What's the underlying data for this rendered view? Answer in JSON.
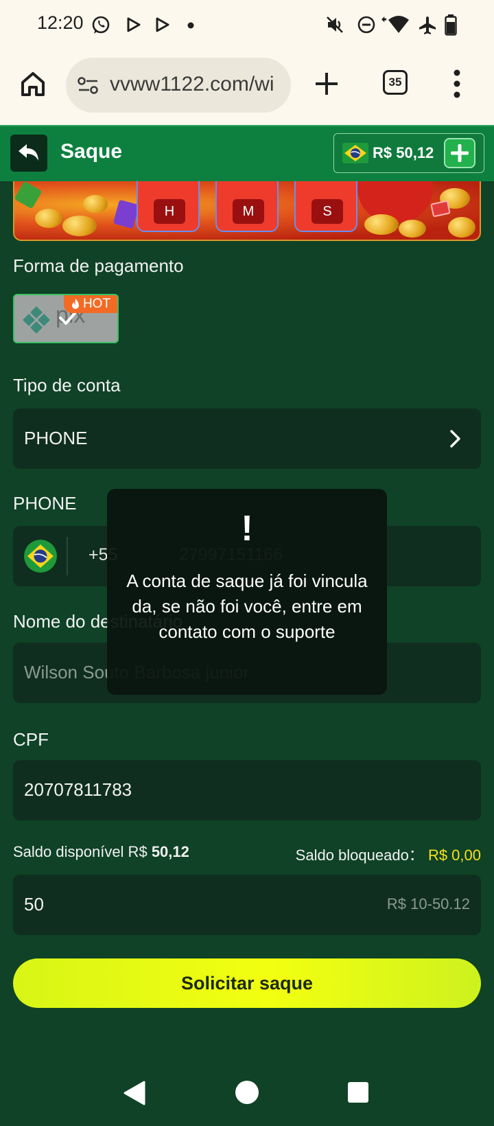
{
  "status_bar": {
    "time": "12:20",
    "left_icons": [
      "whatsapp-icon",
      "play-store-icon",
      "play-store-icon",
      "dot-icon"
    ],
    "right_icons": [
      "mute-icon",
      "do-not-disturb-icon",
      "wifi-icon",
      "airplane-icon",
      "battery-icon"
    ]
  },
  "browser": {
    "url": "vvww1122.com/wi",
    "tab_count": "35"
  },
  "header": {
    "title": "Saque",
    "balance": "R$ 50,12"
  },
  "banner": {
    "units": [
      "H",
      "M",
      "S"
    ]
  },
  "payment": {
    "label": "Forma de pagamento",
    "method_badge": "HOT",
    "method_name": "pix"
  },
  "account_type": {
    "label": "Tipo de conta",
    "value": "PHONE"
  },
  "phone": {
    "label": "PHONE",
    "country_code": "+55",
    "number": "27997151166"
  },
  "recipient": {
    "label": "Nome do destinatário",
    "value": "Wilson Souto Barbosa junior"
  },
  "cpf": {
    "label": "CPF",
    "value": "20707811783"
  },
  "balance_info": {
    "available_label": "Saldo disponível R$",
    "available_value": "50,12",
    "blocked_label": "Saldo bloqueado：",
    "blocked_value": "R$ 0,00"
  },
  "amount": {
    "value": "50",
    "range_hint": "R$ 10-50.12"
  },
  "submit_label": "Solicitar saque",
  "toast": {
    "mark": "!",
    "message": "A conta de saque já foi vinculada, se não foi você, entre em contato com o suporte"
  },
  "colors": {
    "header_green": "#0d8040",
    "background": "#0f4226",
    "accent_yellow": "#f3ff10",
    "blocked_value": "#f6e21a",
    "hot_orange": "#f26a24"
  }
}
